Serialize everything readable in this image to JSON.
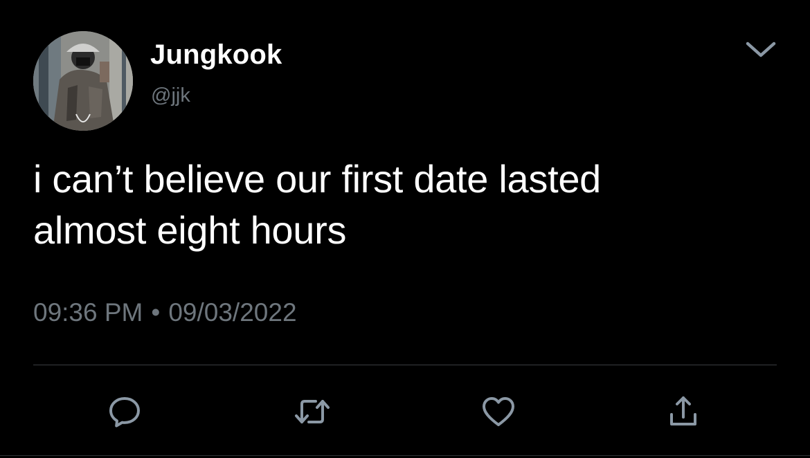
{
  "user": {
    "display_name": "Jungkook",
    "handle": "@jjk"
  },
  "tweet": {
    "text_line_1": "i can’t believe our first date lasted",
    "text_line_2": "almost eight hours",
    "time": "09:36 PM",
    "separator": "•",
    "date": "09/03/2022"
  },
  "icons": {
    "more": "chevron-down-icon",
    "reply": "reply-icon",
    "retweet": "retweet-icon",
    "like": "heart-icon",
    "share": "share-icon"
  },
  "colors": {
    "background": "#000000",
    "text_primary": "#ffffff",
    "text_secondary": "#6e767d",
    "icon": "#8b98a5",
    "divider": "#3a3d41"
  }
}
